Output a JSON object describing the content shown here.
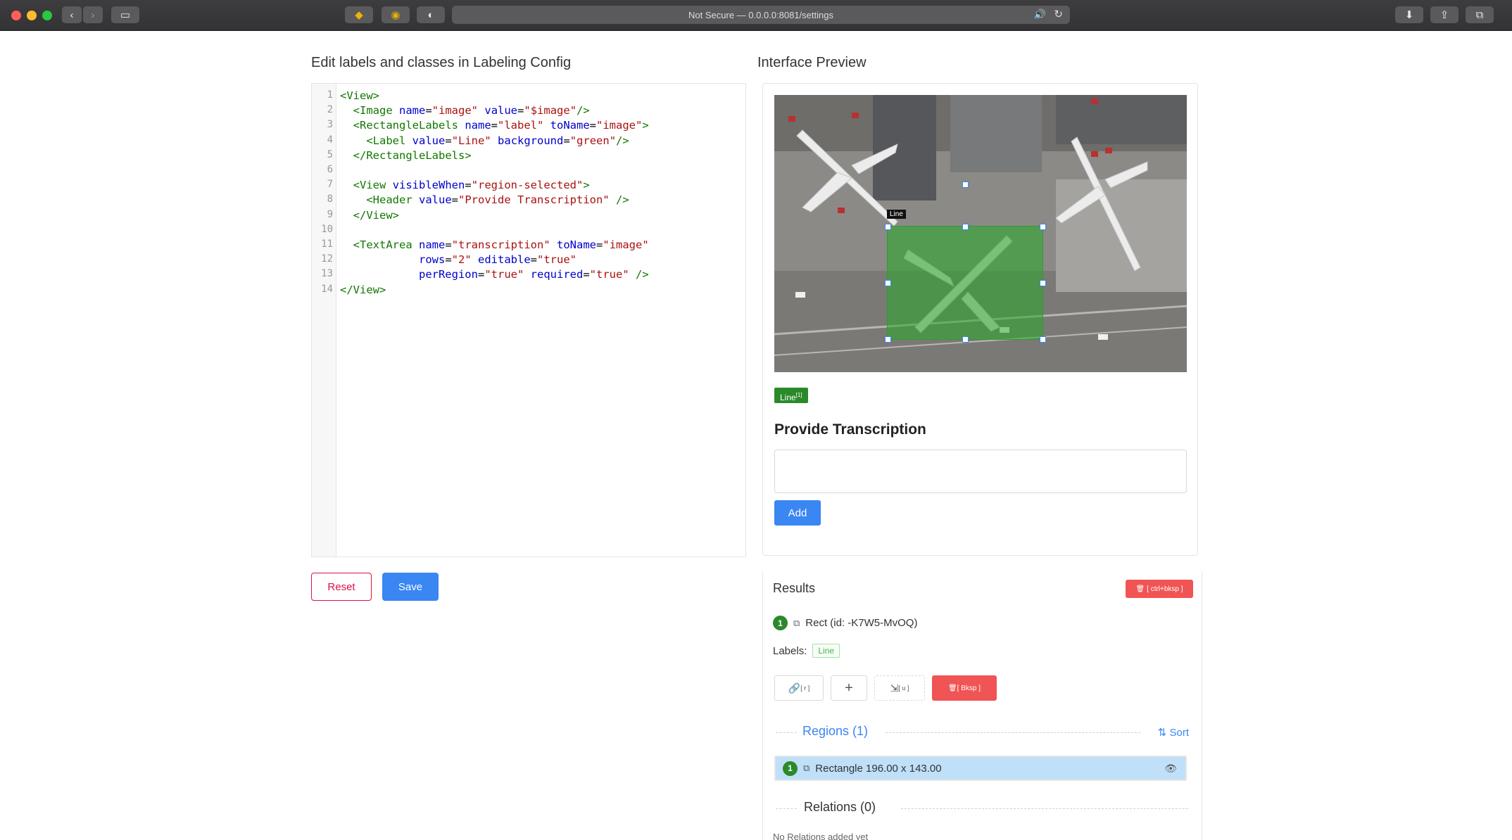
{
  "browser": {
    "url_text": "Not Secure — 0.0.0.0:8081/settings"
  },
  "left": {
    "heading": "Edit labels and classes in Labeling Config",
    "code_lines": [
      "<View>",
      "  <Image name=\"image\" value=\"$image\"/>",
      "  <RectangleLabels name=\"label\" toName=\"image\">",
      "    <Label value=\"Line\" background=\"green\"/>",
      "  </RectangleLabels>",
      "",
      "  <View visibleWhen=\"region-selected\">",
      "    <Header value=\"Provide Transcription\" />",
      "  </View>",
      "",
      "  <TextArea name=\"transcription\" toName=\"image\"",
      "            rows=\"2\" editable=\"true\"",
      "            perRegion=\"true\" required=\"true\" />",
      "</View>"
    ],
    "reset_label": "Reset",
    "save_label": "Save"
  },
  "preview": {
    "heading": "Interface Preview",
    "bbox_label": "Line",
    "label_chip": "Line",
    "label_chip_hotkey": "[1]",
    "header": "Provide Transcription",
    "add_label": "Add"
  },
  "results": {
    "title": "Results",
    "delete_all_hotkey": "[ ctrl+bksp ]",
    "item_number": "1",
    "rect_text": "Rect (id: -K7W5-MvOQ)",
    "labels_prefix": "Labels:",
    "label_tag": "Line",
    "relation_hotkey": "[ r ]",
    "unselect_hotkey": "[ u ]",
    "delete_hotkey": "[ Bksp ]",
    "regions_title": "Regions (1)",
    "sort_label": "Sort",
    "region_text": "Rectangle 196.00 x 143.00",
    "relations_title": "Relations (0)",
    "no_relations_text": "No Relations added yet"
  },
  "colors": {
    "accent_blue": "#3a86f2",
    "danger_red": "#f05454",
    "label_green": "#2a8a2a"
  }
}
